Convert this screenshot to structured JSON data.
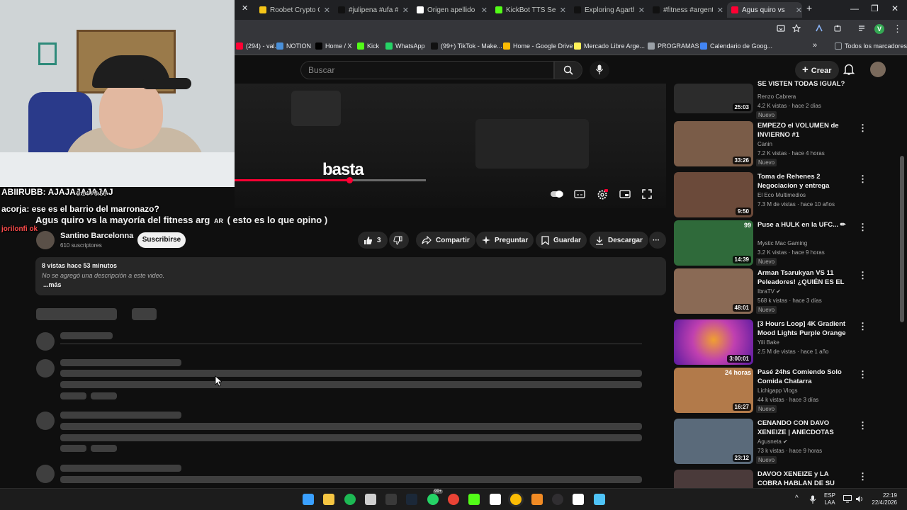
{
  "browser": {
    "tabs": [
      {
        "label": "Roobet Crypto Ca",
        "icon_color": "#f5c518",
        "active": false
      },
      {
        "label": "#julipena #ufa #v",
        "icon_color": "#111111",
        "active": false
      },
      {
        "label": "Origen apellido G",
        "icon_color": "#ffffff",
        "active": false
      },
      {
        "label": "KickBot TTS Settin",
        "icon_color": "#53fc18",
        "active": false
      },
      {
        "label": "Exploring Agartha",
        "icon_color": "#111111",
        "active": false
      },
      {
        "label": "#fitness #argentin",
        "icon_color": "#111111",
        "active": false
      },
      {
        "label": "Agus quiro vs",
        "icon_color": "#ff0033",
        "active": true
      }
    ],
    "new_tab": "+",
    "window_controls": {
      "minimize": "—",
      "maximize": "❐",
      "close": "✕"
    },
    "profile_initial": "V",
    "bookmarks": [
      {
        "label": "(294) - val...",
        "icon_color": "#ff0033"
      },
      {
        "label": "NOTION",
        "icon_color": "#4a90d9"
      },
      {
        "label": "Home / X",
        "icon_color": "#000000"
      },
      {
        "label": "Kick",
        "icon_color": "#53fc18"
      },
      {
        "label": "WhatsApp",
        "icon_color": "#25d366"
      },
      {
        "label": "(99+) TikTok - Make...",
        "icon_color": "#111111"
      },
      {
        "label": "Home - Google Drive",
        "icon_color": "#fbbc04"
      },
      {
        "label": "Mercado Libre Arge...",
        "icon_color": "#fff159"
      },
      {
        "label": "PROGRAMAS",
        "icon_color": "#9aa0a6"
      },
      {
        "label": "Calendario de Goog...",
        "icon_color": "#4285f4"
      }
    ],
    "bookmarks_overflow": "»",
    "all_bookmarks": "Todos los marcadores"
  },
  "youtube": {
    "search_placeholder": "Buscar",
    "create_label": "Crear",
    "player": {
      "caption": "basta",
      "time": "5:14 / 8:56",
      "progress": 0.6
    },
    "video": {
      "title": "Agus quiro vs la mayoría del fitness arg",
      "title_flag": "AR",
      "title_suffix": "( esto es lo que opino )",
      "channel": "Santino Barcelonna",
      "subscribers": "610 suscriptores",
      "subscribe_label": "Suscribirse",
      "likes": "3",
      "share_label": "Compartir",
      "ask_label": "Preguntar",
      "save_label": "Guardar",
      "download_label": "Descargar",
      "more": "···"
    },
    "description": {
      "meta": "8 vistas  hace 53 minutos",
      "text": "No se agregó una descripción a este video.",
      "more": "...más"
    },
    "recommendations": [
      {
        "title": "SE VISTEN TODAS IGUAL?",
        "channel": "Renzo Cabrera",
        "meta": "4.2 K vistas · hace 2 días",
        "badge": "Nuevo",
        "duration": "25:03",
        "thumb": "#2c2c2c",
        "verified": false,
        "top_badge": ""
      },
      {
        "title": "EMPEZO el VOLUMEN de INVIERNO #1",
        "channel": "Canin",
        "meta": "7.2 K vistas · hace 4 horas",
        "badge": "Nuevo",
        "duration": "33:26",
        "thumb": "#7a5c48",
        "verified": false,
        "top_badge": ""
      },
      {
        "title": "Toma de Rehenes 2 Negociacion y entrega",
        "channel": "El Eco Multimedios",
        "meta": "7.3 M de vistas · hace 10 años",
        "badge": "",
        "duration": "9:50",
        "thumb": "#6b4a3a",
        "verified": false,
        "top_badge": ""
      },
      {
        "title": "Puse a HULK en la UFC... ✏",
        "channel": "Mystic Mac Gaming",
        "meta": "3.2 K vistas · hace 9 horas",
        "badge": "Nuevo",
        "duration": "14:39",
        "thumb": "#2f6a3a",
        "verified": false,
        "top_badge": "99"
      },
      {
        "title": "Arman Tsarukyan VS 11 Peleadores! ¿QUIÉN ES EL ...",
        "channel": "IbraTV",
        "meta": "568 k vistas · hace 3 días",
        "badge": "Nuevo",
        "duration": "48:01",
        "thumb": "#8a6a55",
        "verified": true,
        "top_badge": ""
      },
      {
        "title": "[3 Hours Loop] 4K Gradient Mood Lights Purple Orange |...",
        "channel": "Yili Bake",
        "meta": "2.5 M de vistas · hace 1 año",
        "badge": "",
        "duration": "3:00:01",
        "thumb": "gradient",
        "verified": false,
        "top_badge": ""
      },
      {
        "title": "Pasé 24hs Comiendo Solo Comida Chatarra",
        "channel": "Lichigapp Vlogs",
        "meta": "44 k vistas · hace 3 días",
        "badge": "Nuevo",
        "duration": "16:27",
        "thumb": "#b27a4a",
        "verified": false,
        "top_badge": "24 horas"
      },
      {
        "title": "CENANDO CON DAVO XENEIZE | ANECDOTAS CON MUJERES ...",
        "channel": "Agusneta",
        "meta": "73 k vistas · hace 9 horas",
        "badge": "Nuevo",
        "duration": "23:12",
        "thumb": "#5a6a7a",
        "verified": true,
        "top_badge": ""
      },
      {
        "title": "DAVOO XENEIZE y LA COBRA HABLAN DE SU VIDA PRIVAD...",
        "channel": "",
        "meta": "",
        "badge": "",
        "duration": "",
        "thumb": "#4a3a3a",
        "verified": false,
        "top_badge": ""
      }
    ]
  },
  "stream_overlay": {
    "chat": [
      {
        "user": "ABIIRUBB:",
        "text": "AJAJAJAJAJAJ"
      },
      {
        "user": "acorja:",
        "text": "ese es el barrio del marronazo?"
      },
      {
        "user": "jorilonfi",
        "text": "ok"
      }
    ]
  },
  "taskbar": {
    "apps": [
      {
        "name": "windows-start",
        "color": "#3aa0ff"
      },
      {
        "name": "file-explorer",
        "color": "#f5c542"
      },
      {
        "name": "spotify",
        "color": "#1db954"
      },
      {
        "name": "store",
        "color": "#cfcfcf"
      },
      {
        "name": "terminal",
        "color": "#3a3a3a"
      },
      {
        "name": "steam",
        "color": "#1b2838"
      },
      {
        "name": "whatsapp",
        "color": "#25d366"
      },
      {
        "name": "chrome",
        "color": "#ea4335"
      },
      {
        "name": "kick",
        "color": "#53fc18"
      },
      {
        "name": "notion",
        "color": "#ffffff"
      },
      {
        "name": "chrome-active",
        "color": "#fbbc04"
      },
      {
        "name": "app-orange",
        "color": "#f08a24"
      },
      {
        "name": "obs",
        "color": "#302e31"
      },
      {
        "name": "capcut",
        "color": "#ffffff"
      },
      {
        "name": "notepad",
        "color": "#4fc3f7"
      }
    ],
    "badge": "99+",
    "language": "ESP",
    "language_sub": "LAA",
    "time": "22:19",
    "date": "22/4/2026",
    "tray_up": "^"
  }
}
